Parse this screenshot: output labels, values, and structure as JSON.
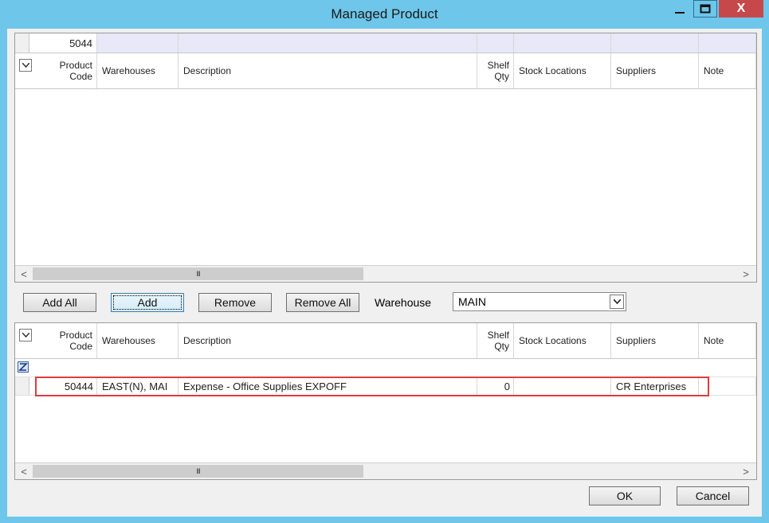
{
  "window": {
    "title": "Managed Product",
    "min_icon": "minimize-icon",
    "max_icon": "maximize-icon",
    "close_icon": "close-icon",
    "close_glyph": "X"
  },
  "top_grid": {
    "filter_value": "5044",
    "columns": {
      "product_code": "Product\nCode",
      "warehouses": "Warehouses",
      "description": "Description",
      "shelf_qty": "Shelf\nQty",
      "stock_locations": "Stock Locations",
      "suppliers": "Suppliers",
      "note": "Note"
    },
    "rows": []
  },
  "actions": {
    "add_all": "Add All",
    "add": "Add",
    "remove": "Remove",
    "remove_all": "Remove All",
    "warehouse_label": "Warehouse",
    "warehouse_value": "MAIN"
  },
  "bottom_grid": {
    "columns": {
      "product_code": "Product\nCode",
      "warehouses": "Warehouses",
      "description": "Description",
      "shelf_qty": "Shelf\nQty",
      "stock_locations": "Stock Locations",
      "suppliers": "Suppliers",
      "note": "Note"
    },
    "rows": [
      {
        "product_code": "50444",
        "warehouses": "EAST(N), MAI",
        "description": "Expense - Office Supplies EXPOFF",
        "shelf_qty": "0",
        "stock_locations": "",
        "suppliers": "CR Enterprises",
        "note": ""
      }
    ]
  },
  "scroll": {
    "left": "<",
    "right": ">",
    "grip": "III"
  },
  "footer": {
    "ok": "OK",
    "cancel": "Cancel"
  },
  "colors": {
    "title_bar": "#6ec6ea",
    "close_button": "#c7484a",
    "highlight": "#e03c3c",
    "filter_row": "#e8e8f8"
  }
}
